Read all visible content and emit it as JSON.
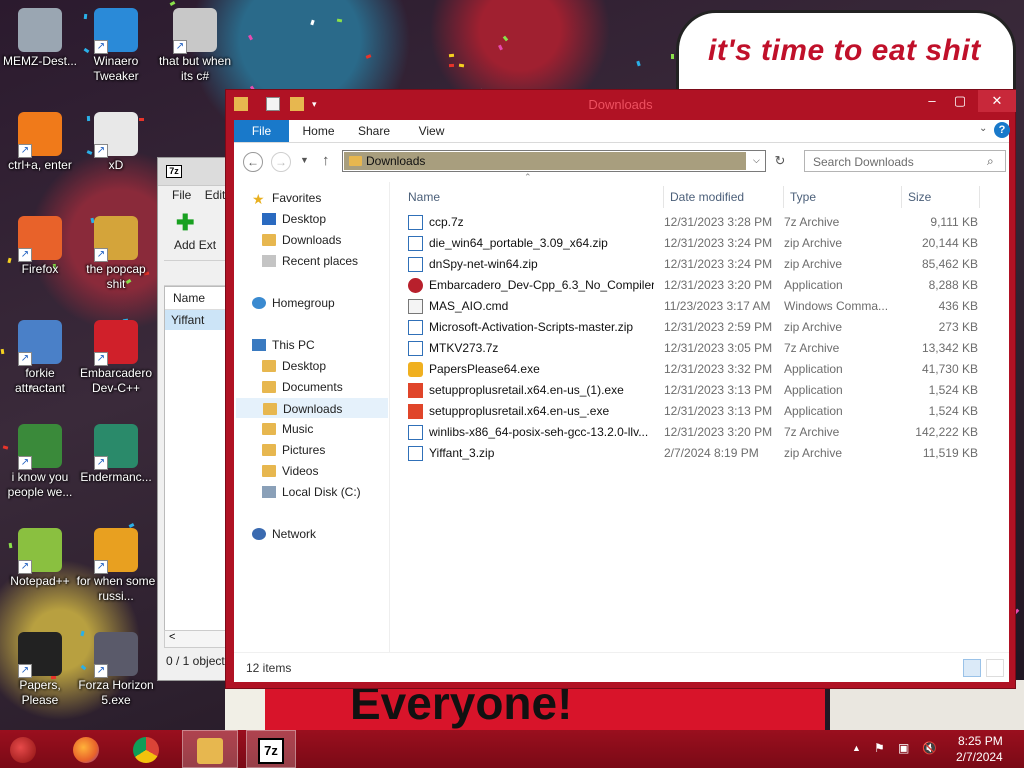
{
  "wallpaper": {
    "speech_text": "it's time to eat shit",
    "banner_text": "Everyone!"
  },
  "desktop_icons": [
    {
      "label": "MEMZ-Dest...",
      "icon": "recycle-bin-icon",
      "color": "#9aa6b2"
    },
    {
      "label": "Winaero Tweaker",
      "icon": "winaero-icon",
      "color": "#2a8ad8"
    },
    {
      "label": "that but when its c#",
      "icon": "stacked-windows-icon",
      "color": "#c8c8c8"
    },
    {
      "label": "ctrl+a, enter",
      "icon": "ring-icon",
      "color": "#f07a1a"
    },
    {
      "label": "xD",
      "icon": "hxd-icon",
      "color": "#e8e8e8"
    },
    {
      "label": "Firefox",
      "icon": "firefox-icon",
      "color": "#e8622a"
    },
    {
      "label": "the popcap shit",
      "icon": "popcap-icon",
      "color": "#d4a43a"
    },
    {
      "label": "forkie attractant",
      "icon": "settings-monitor-icon",
      "color": "#4a80c8"
    },
    {
      "label": "Embarcadero Dev-C++",
      "icon": "devcpp-icon",
      "color": "#d0202a"
    },
    {
      "label": "i know you people we...",
      "icon": "chrome-icon",
      "color": "#3a8a3a"
    },
    {
      "label": "Endermanc...",
      "icon": "screen-icon",
      "color": "#2a8a6a"
    },
    {
      "label": "Notepad++",
      "icon": "notepadpp-icon",
      "color": "#8ac040"
    },
    {
      "label": "for when some russi...",
      "icon": "de-icon",
      "color": "#e8a020"
    },
    {
      "label": "Papers, Please",
      "icon": "papers-please-icon",
      "color": "#222222"
    },
    {
      "label": "Forza Horizon 5.exe",
      "icon": "flash-icon",
      "color": "#5a5a6a"
    }
  ],
  "sevenzip": {
    "menu": [
      "File",
      "Edit"
    ],
    "toolbar_add": "Add",
    "toolbar_extract": "Ext",
    "column_name": "Name",
    "row": "Yiffant",
    "status": "0 / 1 object"
  },
  "explorer": {
    "title": "Downloads",
    "tabs": [
      "File",
      "Home",
      "Share",
      "View"
    ],
    "address": "Downloads",
    "search_placeholder": "Search Downloads",
    "nav": {
      "favorites": "Favorites",
      "desktop": "Desktop",
      "downloads": "Downloads",
      "recent": "Recent places",
      "homegroup": "Homegroup",
      "this_pc": "This PC",
      "pc_desktop": "Desktop",
      "documents": "Documents",
      "pc_downloads": "Downloads",
      "music": "Music",
      "pictures": "Pictures",
      "videos": "Videos",
      "local_disk": "Local Disk (C:)",
      "network": "Network"
    },
    "columns": {
      "name": "Name",
      "date": "Date modified",
      "type": "Type",
      "size": "Size"
    },
    "files": [
      {
        "name": "ccp.7z",
        "date": "12/31/2023 3:28 PM",
        "type": "7z Archive",
        "size": "9,111 KB",
        "icon": "zip-icon"
      },
      {
        "name": "die_win64_portable_3.09_x64.zip",
        "date": "12/31/2023 3:24 PM",
        "type": "zip Archive",
        "size": "20,144 KB",
        "icon": "zip-icon"
      },
      {
        "name": "dnSpy-net-win64.zip",
        "date": "12/31/2023 3:24 PM",
        "type": "zip Archive",
        "size": "85,462 KB",
        "icon": "zip-icon"
      },
      {
        "name": "Embarcadero_Dev-Cpp_6.3_No_Compiler...",
        "date": "12/31/2023 3:20 PM",
        "type": "Application",
        "size": "8,288 KB",
        "icon": "app-icon"
      },
      {
        "name": "MAS_AIO.cmd",
        "date": "11/23/2023 3:17 AM",
        "type": "Windows Comma...",
        "size": "436 KB",
        "icon": "cmd-icon"
      },
      {
        "name": "Microsoft-Activation-Scripts-master.zip",
        "date": "12/31/2023 2:59 PM",
        "type": "zip Archive",
        "size": "273 KB",
        "icon": "zip-icon"
      },
      {
        "name": "MTKV273.7z",
        "date": "12/31/2023 3:05 PM",
        "type": "7z Archive",
        "size": "13,342 KB",
        "icon": "zip-icon"
      },
      {
        "name": "PapersPlease64.exe",
        "date": "12/31/2023 3:32 PM",
        "type": "Application",
        "size": "41,730 KB",
        "icon": "papers-icon"
      },
      {
        "name": "setupproplusretail.x64.en-us_(1).exe",
        "date": "12/31/2023 3:13 PM",
        "type": "Application",
        "size": "1,524 KB",
        "icon": "office-icon"
      },
      {
        "name": "setupproplusretail.x64.en-us_.exe",
        "date": "12/31/2023 3:13 PM",
        "type": "Application",
        "size": "1,524 KB",
        "icon": "office-icon"
      },
      {
        "name": "winlibs-x86_64-posix-seh-gcc-13.2.0-llv...",
        "date": "12/31/2023 3:20 PM",
        "type": "7z Archive",
        "size": "142,222 KB",
        "icon": "zip-icon"
      },
      {
        "name": "Yiffant_3.zip",
        "date": "2/7/2024 8:19 PM",
        "type": "zip Archive",
        "size": "11,519 KB",
        "icon": "zip-icon"
      }
    ],
    "status": "12 items"
  },
  "taskbar": {
    "time": "8:25 PM",
    "date": "2/7/2024"
  }
}
